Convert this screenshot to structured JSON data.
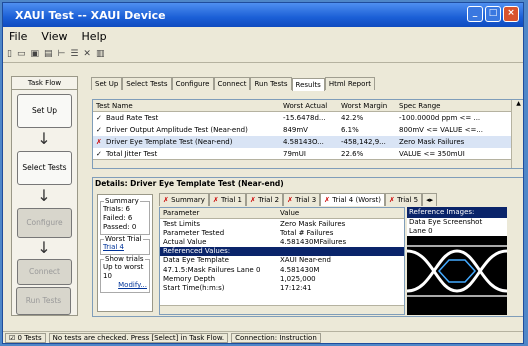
{
  "window": {
    "title": "XAUI Test -- XAUI Device"
  },
  "menu": [
    "File",
    "View",
    "Help"
  ],
  "toolbar_icons": [
    "new-icon",
    "open-icon",
    "save-icon",
    "print-icon",
    "tree-icon",
    "list-icon",
    "cut-icon",
    "bars-icon"
  ],
  "flow": {
    "header": "Task Flow",
    "steps": [
      {
        "label": "Set Up",
        "enabled": true
      },
      {
        "label": "Select Tests",
        "enabled": true
      },
      {
        "label": "Configure",
        "enabled": false
      },
      {
        "label": "Connect",
        "enabled": false
      },
      {
        "label": "Run Tests",
        "enabled": false
      }
    ]
  },
  "tabs": [
    "Set Up",
    "Select Tests",
    "Configure",
    "Connect",
    "Run Tests",
    "Results",
    "Html Report"
  ],
  "active_tab": "Results",
  "tests": {
    "columns": [
      "Test Name",
      "Worst Actual",
      "Worst Margin",
      "Spec Range"
    ],
    "rows": [
      {
        "status": "pass",
        "name": "Baud Rate Test",
        "actual": "-15.6478d...",
        "margin": "42.2%",
        "spec": "-100.0000d ppm <= ..."
      },
      {
        "status": "pass",
        "name": "Driver Output Amplitude Test (Near-end)",
        "actual": "849mV",
        "margin": "6.1%",
        "spec": "800mV <= VALUE <=..."
      },
      {
        "status": "fail",
        "name": "Driver Eye Template Test (Near-end)",
        "actual": "4.58143O...",
        "margin": "-458,142,9...",
        "spec": "Zero Mask Failures"
      },
      {
        "status": "pass",
        "name": "Total Jitter Test",
        "actual": "79mUI",
        "margin": "22.6%",
        "spec": "VALUE <= 350mUI"
      }
    ]
  },
  "details": {
    "title": "Details: Driver Eye Template Test (Near-end)",
    "summary": {
      "legend": "Summary",
      "trials": "Trials: 6",
      "failed": "Failed: 6",
      "passed": "Passed: 0"
    },
    "worst": {
      "legend": "Worst Trial",
      "link": "Trial 4"
    },
    "show": {
      "legend": "Show trials",
      "text": "Up to worst 10",
      "link": "Modify..."
    },
    "tabs": [
      "Summary",
      "Trial 1",
      "Trial 2",
      "Trial 3",
      "Trial 4 (Worst)",
      "Trial 5"
    ],
    "active_tab": "Trial 4 (Worst)",
    "params": {
      "columns": [
        "Parameter",
        "Value"
      ],
      "rows": [
        {
          "p": "Test Limits",
          "v": "Zero Mask Failures"
        },
        {
          "p": "Parameter Tested",
          "v": "Total # Failures"
        },
        {
          "p": "Actual Value",
          "v": "4.581430MFailures"
        },
        {
          "p": "Referenced Values:",
          "v": ""
        },
        {
          "p": "Data Eye Template",
          "v": "XAUI Near-end"
        },
        {
          "p": "47.1.5:Mask Failures Lane 0",
          "v": "4.581430M"
        },
        {
          "p": "Memory Depth",
          "v": "1,025,000"
        },
        {
          "p": "Start Time(h:m:s)",
          "v": "17:12:41"
        }
      ]
    },
    "ref": {
      "header": "Reference Images:",
      "lines": [
        "Data Eye Screenshot",
        "Lane 0"
      ]
    }
  },
  "status_bar": [
    "0 Tests",
    "No tests are checked. Press [Select] in Task Flow.",
    "Connection: Instruction"
  ],
  "colors": {
    "title": "#1b5fd6",
    "selection": "#0a246a",
    "fail": "#cc0000"
  }
}
